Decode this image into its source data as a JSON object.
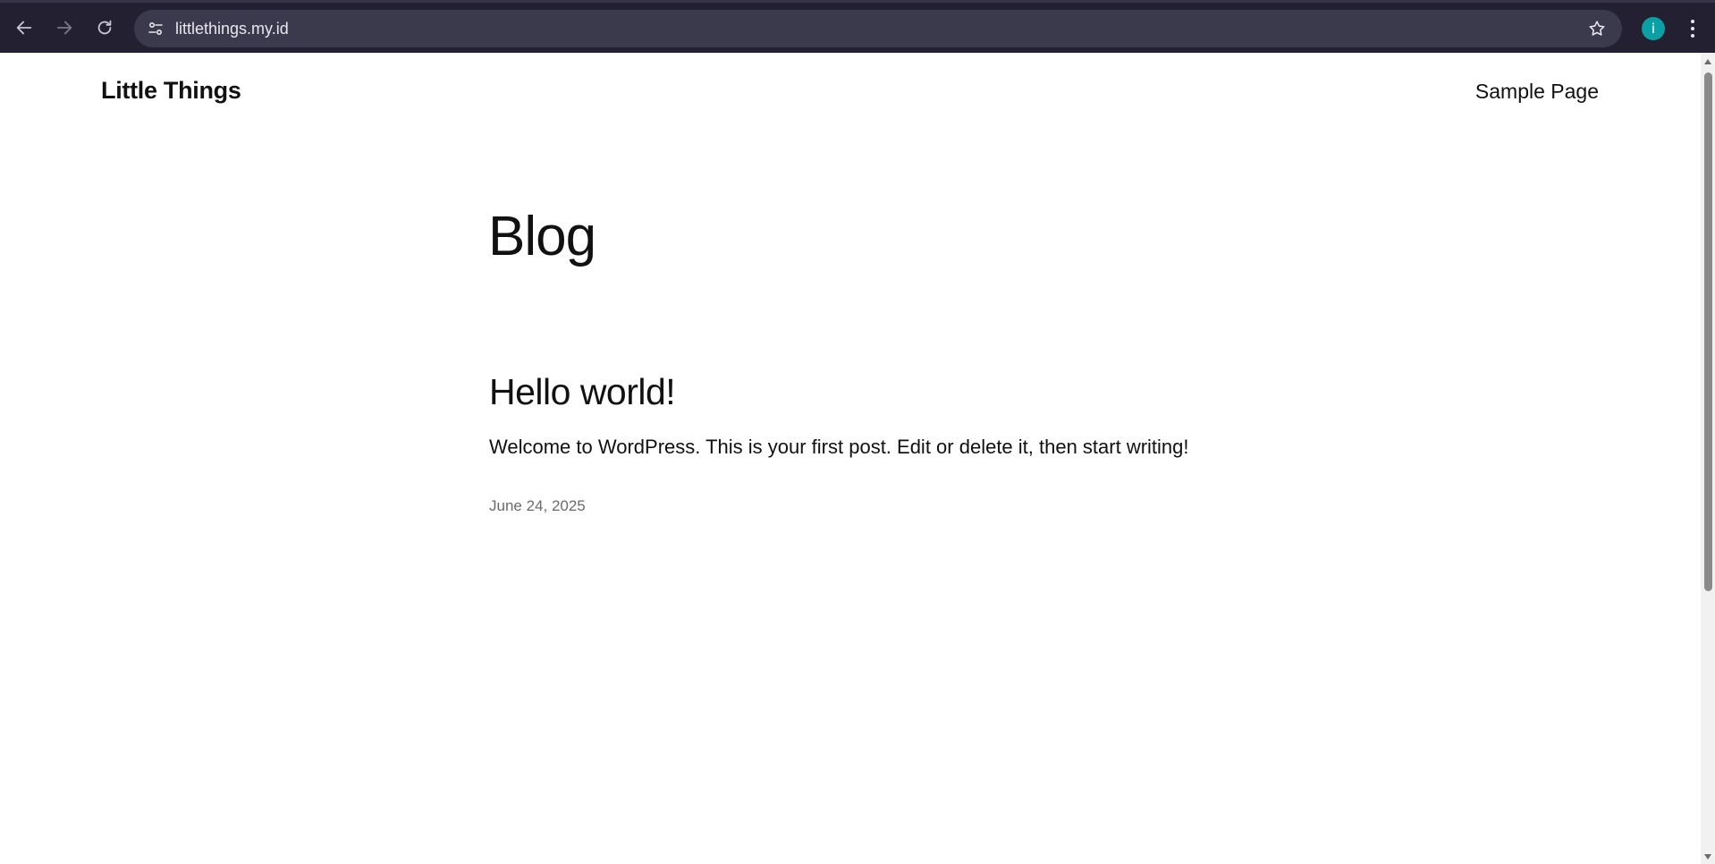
{
  "browser": {
    "url": "littlethings.my.id",
    "profile_initial": "i",
    "icons": {
      "back": "arrow-left-icon",
      "forward": "arrow-right-icon",
      "reload": "reload-icon",
      "site_info": "tune-icon",
      "bookmark": "star-icon",
      "menu": "kebab-menu-icon"
    },
    "colors": {
      "toolbar": "#232131",
      "omnibox": "#3b3a4c",
      "profile": "#0aa0a5"
    }
  },
  "site": {
    "title": "Little Things",
    "nav": [
      "Sample Page"
    ]
  },
  "main": {
    "heading": "Blog",
    "posts": [
      {
        "title": "Hello world!",
        "excerpt": "Welcome to WordPress. This is your first post. Edit or delete it, then start writing!",
        "date": "June 24, 2025"
      }
    ]
  }
}
